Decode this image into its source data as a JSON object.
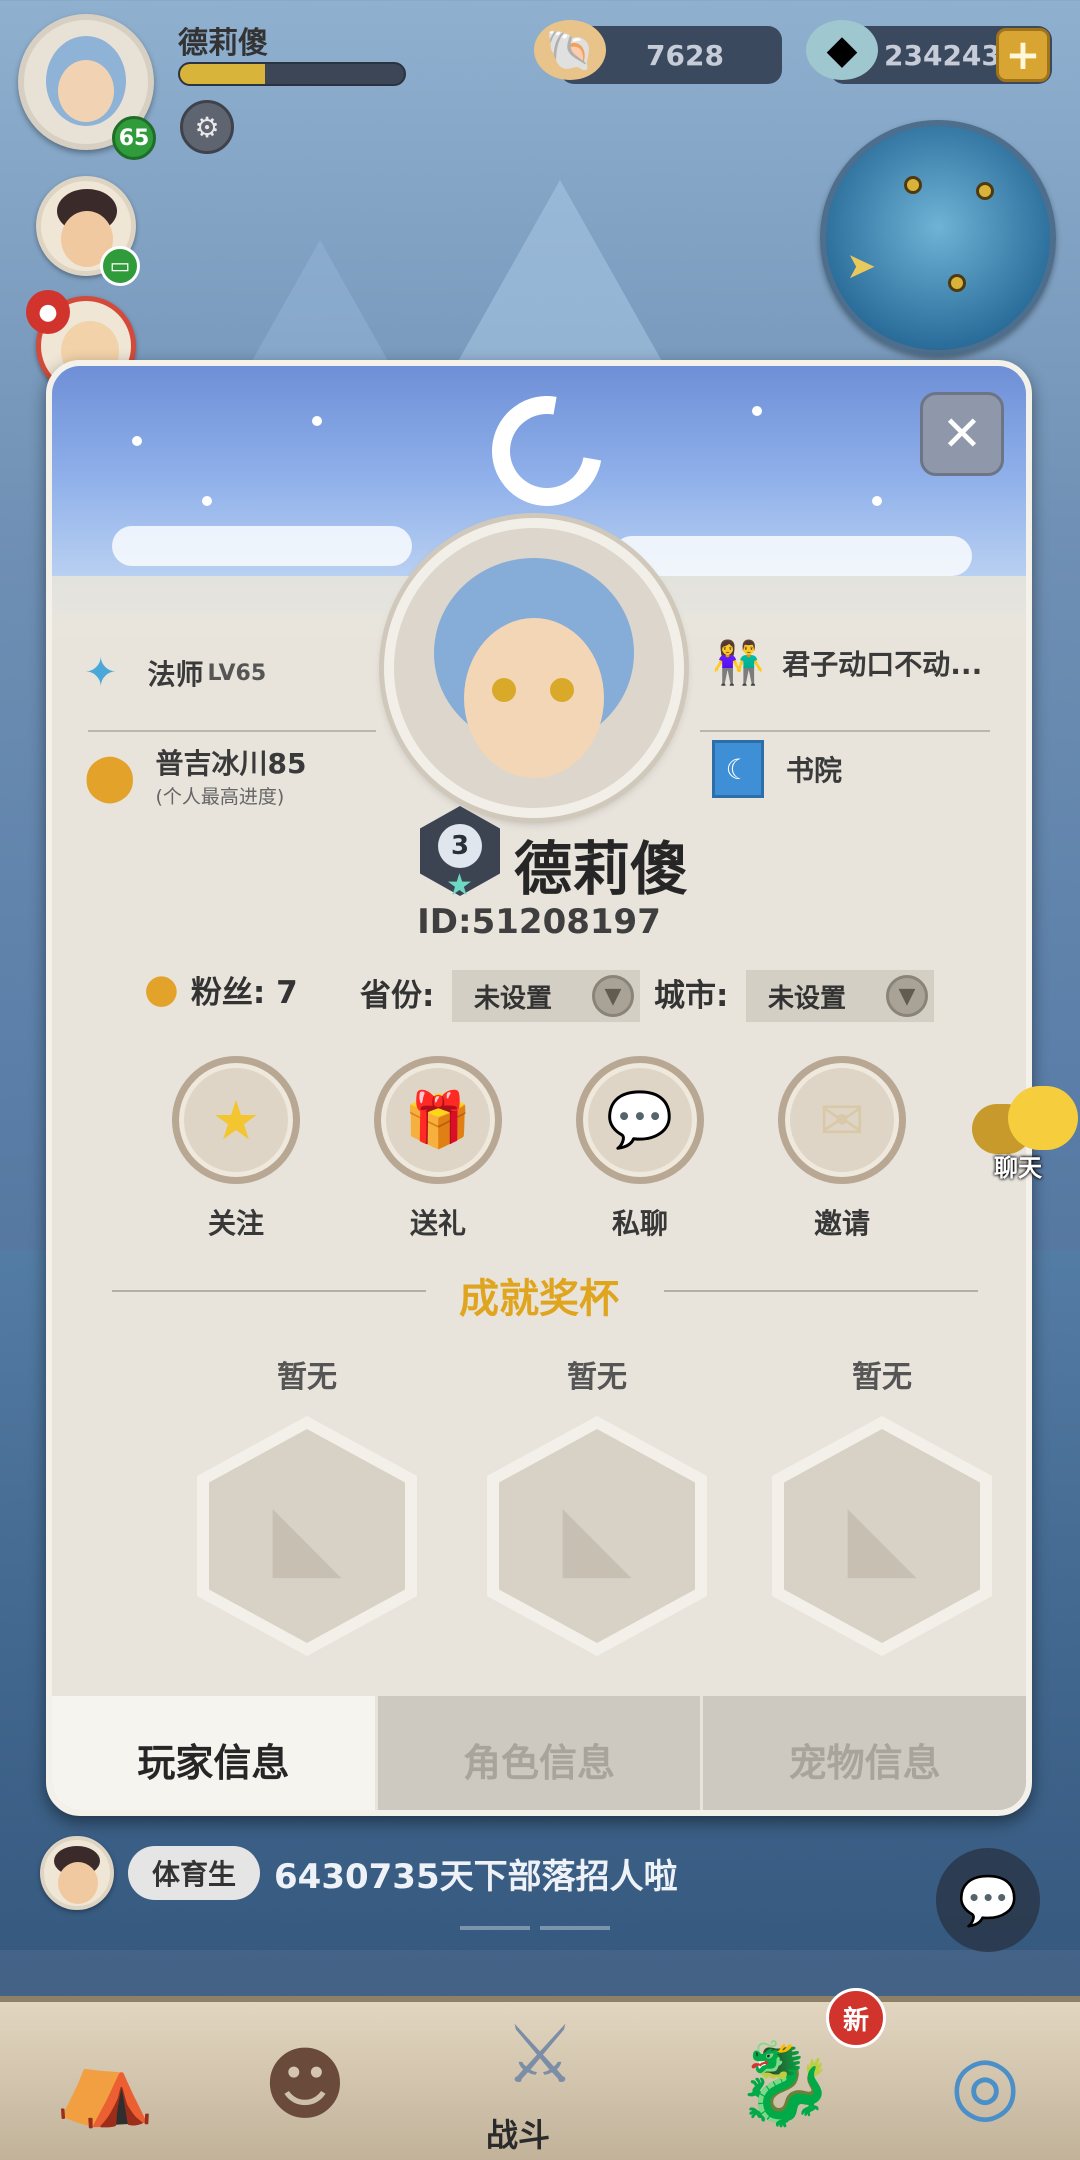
{
  "player_hud": {
    "name": "德莉傻",
    "level": "65"
  },
  "resources": {
    "shells": "7628",
    "stones": "234243",
    "add_label": "+"
  },
  "modal": {
    "close_label": "✕",
    "profession": "法师",
    "profession_level": "LV65",
    "team_name": "君子动口不动...",
    "progress_location": "普吉冰川85",
    "progress_note": "(个人最高进度)",
    "academy": "书院",
    "rank": "3",
    "nickname": "德莉傻",
    "player_id": "ID:51208197",
    "fans_label": "粉丝: 7",
    "province_label": "省份:",
    "province_value": "未设置",
    "city_label": "城市:",
    "city_value": "未设置",
    "actions": [
      {
        "label": "关注",
        "icon": "star-icon"
      },
      {
        "label": "送礼",
        "icon": "gift-icon"
      },
      {
        "label": "私聊",
        "icon": "chat-bubble-icon"
      },
      {
        "label": "邀请",
        "icon": "mail-icon"
      }
    ],
    "achievements_title": "成就奖杯",
    "trophies": [
      {
        "label": "暂无"
      },
      {
        "label": "暂无"
      },
      {
        "label": "暂无"
      }
    ],
    "tabs": [
      {
        "label": "玩家信息",
        "active": true
      },
      {
        "label": "角色信息",
        "active": false
      },
      {
        "label": "宠物信息",
        "active": false
      }
    ]
  },
  "chat": {
    "floater_label": "聊天",
    "sender_tag": "体育生",
    "message": "6430735天下部落招人啦"
  },
  "bottom_nav": {
    "fight_label": "战斗",
    "new_badge": "新"
  },
  "colors": {
    "accent_gold": "#e0a51e",
    "modal_bg": "#e8e4dc",
    "level_green": "#2f9b3a",
    "new_red": "#d0342c"
  }
}
